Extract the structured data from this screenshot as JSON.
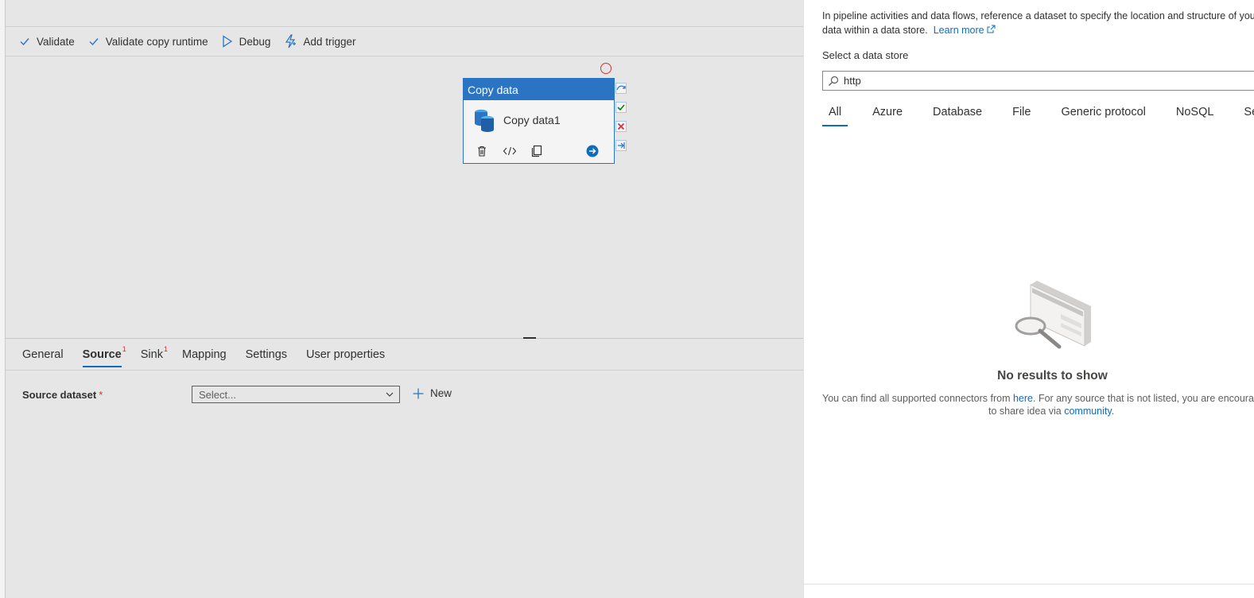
{
  "toolbar": {
    "validate": "Validate",
    "validate_copy_runtime": "Validate copy runtime",
    "debug": "Debug",
    "add_trigger": "Add trigger"
  },
  "activity": {
    "type": "Copy data",
    "name": "Copy data1"
  },
  "bottom_tabs": {
    "general": "General",
    "source": "Source",
    "source_badge": "1",
    "sink": "Sink",
    "sink_badge": "1",
    "mapping": "Mapping",
    "settings": "Settings",
    "user_properties": "User properties"
  },
  "source_form": {
    "label": "Source dataset",
    "required": "*",
    "select_placeholder": "Select...",
    "new_label": "New"
  },
  "panel": {
    "description_line1": "In pipeline activities and data flows, reference a dataset to specify the location and structure of your",
    "description_line2": "data within a data store.",
    "learn_more": "Learn more",
    "store_label": "Select a data store",
    "search_value": "http",
    "tabs": [
      "All",
      "Azure",
      "Database",
      "File",
      "Generic protocol",
      "NoSQL",
      "Services and apps"
    ],
    "empty_title": "No results to show",
    "empty_text_before": "You can find all supported connectors from ",
    "empty_link_here": "here",
    "empty_text_after": ". For any source that is not listed, you are encouraged",
    "empty_text_line2_before": "to share idea via ",
    "empty_link_community": "community",
    "empty_text_line2_after": "."
  },
  "colors": {
    "accent": "#0f6cbd",
    "activity_header": "#2b74c4",
    "error": "#d13438",
    "success": "#107c10"
  }
}
